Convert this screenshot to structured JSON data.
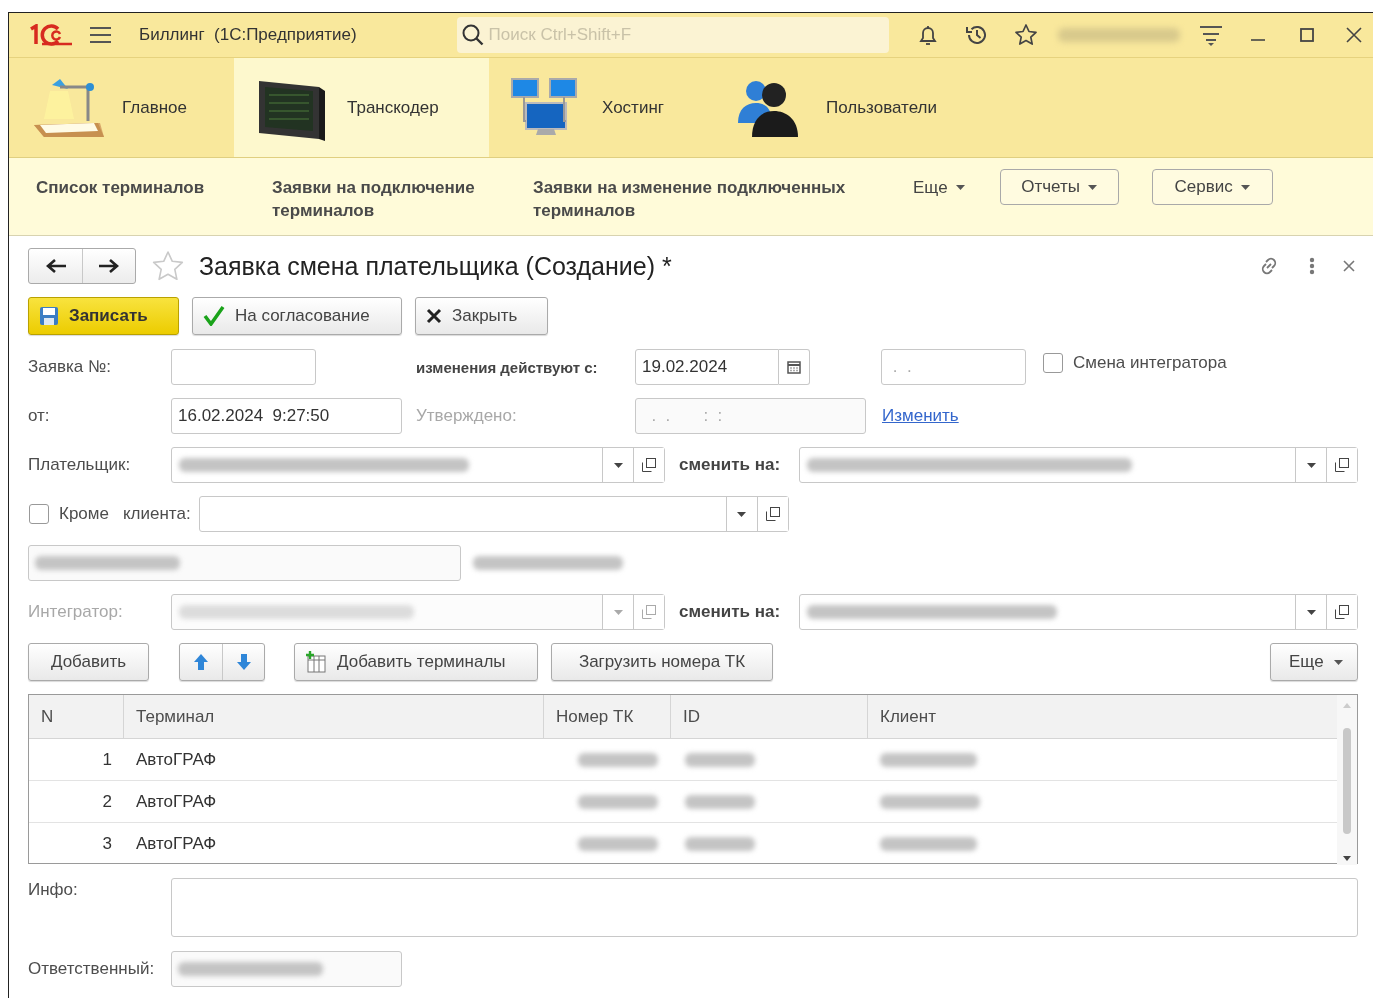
{
  "window": {
    "title": "Биллинг  (1С:Предприятие)",
    "search": {
      "placeholder": "Поиск Ctrl+Shift+F"
    }
  },
  "sections": [
    {
      "label": "Главное",
      "kind": "desk",
      "selected": false
    },
    {
      "label": "Транскодер",
      "kind": "monitor",
      "selected": true
    },
    {
      "label": "Хостинг",
      "kind": "network",
      "selected": false
    },
    {
      "label": "Пользователи",
      "kind": "users",
      "selected": false
    }
  ],
  "nav": {
    "links": [
      "Список терминалов",
      "Заявки на подключение терминалов",
      "Заявки на изменение подключенных терминалов"
    ],
    "more": "Еще",
    "menus": [
      "Отчеты",
      "Сервис"
    ]
  },
  "form": {
    "title": "Заявка смена плательщика (Создание) *",
    "actions": [
      {
        "kind": "save",
        "label": "Записать"
      },
      {
        "kind": "approve",
        "label": "На согласование"
      },
      {
        "kind": "close",
        "label": "Закрыть"
      }
    ],
    "number": {
      "label": "Заявка №:"
    },
    "effective": {
      "label": "изменения действуют с:",
      "value": "19.02.2024"
    },
    "effective_until": {
      "placeholder": " .  ."
    },
    "integrator_change": {
      "label": "Смена интегратора",
      "checked": false
    },
    "date": {
      "label": "от:",
      "value": "16.02.2024  9:27:50"
    },
    "approved": {
      "label": "Утверждено:",
      "placeholder": "  .  .       :  :",
      "disabled": true
    },
    "change_link": "Изменить",
    "payer": {
      "label": "Плательщик:",
      "new_label": "сменить на:",
      "disabled": false
    },
    "except_client": {
      "label": "Кроме",
      "field_label": "клиента:",
      "checked": false
    },
    "integrator": {
      "label": "Интегратор:",
      "new_label": "сменить на:",
      "disabled": true
    },
    "toolbar": [
      {
        "kind": "button",
        "label": "Добавить"
      },
      {
        "kind": "arrows"
      },
      {
        "kind": "add-terminals",
        "label": "Добавить терминалы"
      },
      {
        "kind": "button",
        "label": "Загрузить номера ТК"
      },
      {
        "kind": "more",
        "label": "Еще"
      }
    ],
    "table": {
      "columns": [
        "N",
        "Терминал",
        "Номер ТК",
        "ID",
        "Клиент"
      ],
      "rows": [
        {
          "n": "1",
          "terminal": "АвтоГРАФ"
        },
        {
          "n": "2",
          "terminal": "АвтоГРАФ"
        },
        {
          "n": "3",
          "terminal": "АвтоГРАФ"
        }
      ]
    },
    "info": {
      "label": "Инфо:"
    },
    "responsible": {
      "label": "Ответственный:"
    }
  }
}
